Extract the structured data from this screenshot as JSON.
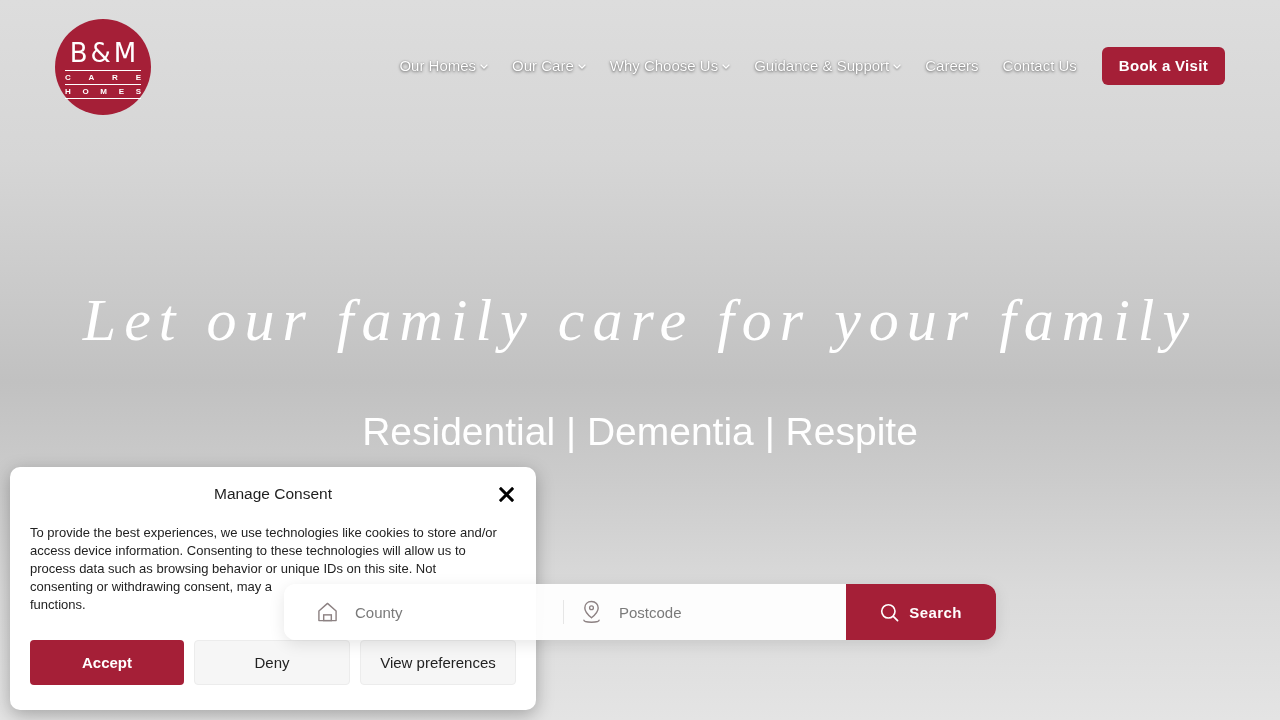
{
  "logo": {
    "title": "B&M",
    "line_1": "C A R E",
    "line_2": "H O M E S"
  },
  "nav": {
    "items": [
      {
        "label": "Our Homes",
        "dropdown": true
      },
      {
        "label": "Our Care",
        "dropdown": true
      },
      {
        "label": "Why Choose Us",
        "dropdown": true
      },
      {
        "label": "Guidance & Support",
        "dropdown": true
      },
      {
        "label": "Careers",
        "dropdown": false
      },
      {
        "label": "Contact Us",
        "dropdown": false
      }
    ],
    "cta": "Book a Visit"
  },
  "hero": {
    "headline": "Let our family care for your family",
    "subheading": "Residential | Dementia | Respite"
  },
  "search": {
    "fields": [
      {
        "kind": "county",
        "placeholder": "County"
      },
      {
        "kind": "postcode",
        "placeholder": "Postcode"
      }
    ],
    "button": "Search"
  },
  "consent": {
    "title": "Manage Consent",
    "message": "To provide the best experiences, we use technologies like cookies to store and/or access device information. Consenting to these technologies will allow us to process data such as browsing behavior or unique IDs on this site. Not",
    "message_cut": "consenting or withdrawing consent, may a",
    "message_end": "functions.",
    "buttons": [
      {
        "label": "Accept",
        "kind": "primary"
      },
      {
        "label": "Deny",
        "kind": "secondary"
      },
      {
        "label": "View preferences",
        "kind": "secondary"
      }
    ]
  }
}
